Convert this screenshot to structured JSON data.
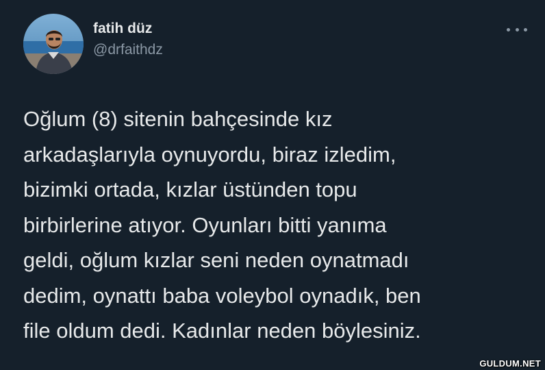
{
  "tweet": {
    "author": {
      "display_name": "fatih düz",
      "handle": "@drfaithdz",
      "avatar_icon": "user-photo-avatar"
    },
    "more_icon": "more-options-icon",
    "text_lines": [
      "Oğlum (8) sitenin bahçesinde kız",
      "arkadaşlarıyla oynuyordu, biraz izledim,",
      "bizimki ortada, kızlar üstünden topu",
      "birbirlerine atıyor. Oyunları bitti yanıma",
      "geldi, oğlum kızlar seni neden oynatmadı",
      "dedim, oynattı baba voleybol oynadık, ben",
      "file oldum dedi. Kadınlar neden böylesiniz."
    ]
  },
  "watermark": "GULDUM.NET",
  "colors": {
    "background": "#15202b",
    "primary_text": "#e7e9ea",
    "secondary_text": "#8b98a5"
  }
}
